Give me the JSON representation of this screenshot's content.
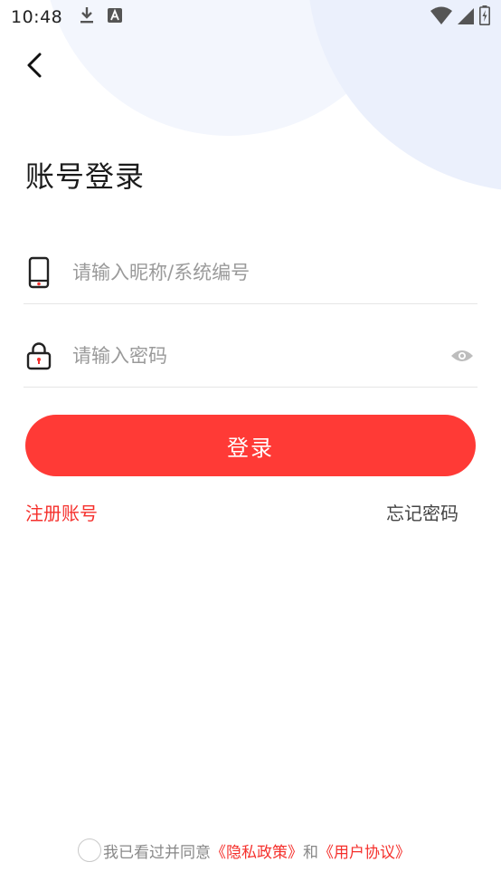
{
  "status_bar": {
    "time": "10:48",
    "left_icons": [
      "download-icon",
      "a-notification-icon"
    ],
    "right_icons": [
      "wifi-icon",
      "signal-icon",
      "battery-charging-icon"
    ]
  },
  "header": {
    "back_icon": "chevron-left-icon"
  },
  "page": {
    "title": "账号登录"
  },
  "form": {
    "username": {
      "icon": "phone-icon",
      "placeholder": "请输入昵称/系统编号",
      "value": ""
    },
    "password": {
      "icon": "lock-icon",
      "placeholder": "请输入密码",
      "value": "",
      "toggle_icon": "eye-icon"
    },
    "login_label": "登录"
  },
  "links": {
    "register": "注册账号",
    "forgot": "忘记密码"
  },
  "agreement": {
    "prefix": "我已看过并同意",
    "privacy": "《隐私政策》",
    "and": "和",
    "user_agreement": "《用户协议》"
  },
  "colors": {
    "accent": "#ff3a36",
    "link_red": "#f5302c",
    "bg_circle": "#ebf0fc"
  }
}
